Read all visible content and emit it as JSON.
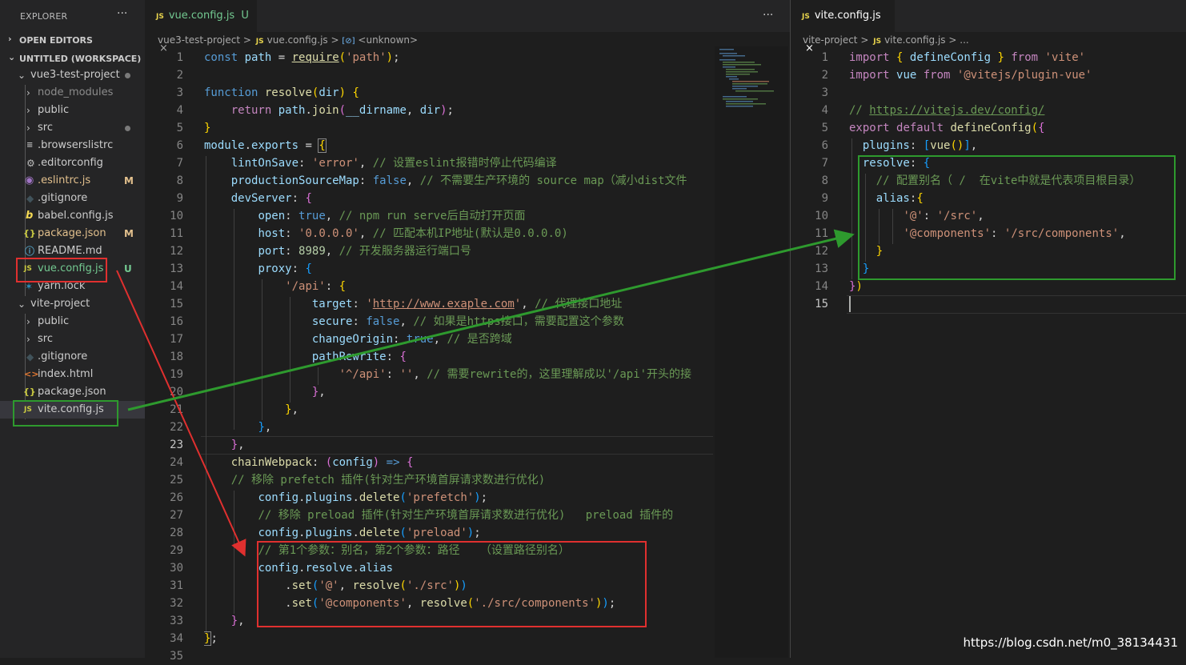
{
  "explorer": {
    "title": "EXPLORER",
    "more": "···",
    "open_editors": "OPEN EDITORS",
    "workspace": "UNTITLED (WORKSPACE)",
    "items": [
      {
        "name": "vue3-test-project",
        "type": "folder",
        "open": true
      },
      {
        "name": "node_modules",
        "type": "folder",
        "open": false
      },
      {
        "name": "public",
        "type": "folder",
        "open": false
      },
      {
        "name": "src",
        "type": "folder",
        "open": false
      },
      {
        "name": ".browserslistrc",
        "type": "file",
        "icon": "lines-icon"
      },
      {
        "name": ".editorconfig",
        "type": "file",
        "icon": "gear-icon"
      },
      {
        "name": ".eslintrc.js",
        "type": "file",
        "icon": "eslint-icon",
        "status": "M"
      },
      {
        "name": ".gitignore",
        "type": "file",
        "icon": "git-icon"
      },
      {
        "name": "babel.config.js",
        "type": "file",
        "icon": "babel-icon"
      },
      {
        "name": "package.json",
        "type": "file",
        "icon": "json-icon",
        "status": "M"
      },
      {
        "name": "README.md",
        "type": "file",
        "icon": "info-icon"
      },
      {
        "name": "vue.config.js",
        "type": "file",
        "icon": "js-icon",
        "status": "U"
      },
      {
        "name": "yarn.lock",
        "type": "file",
        "icon": "yarn-icon"
      },
      {
        "name": "vite-project",
        "type": "folder",
        "open": true
      },
      {
        "name": "public",
        "type": "folder",
        "open": false
      },
      {
        "name": "src",
        "type": "folder",
        "open": false
      },
      {
        "name": ".gitignore",
        "type": "file",
        "icon": "git-icon"
      },
      {
        "name": "index.html",
        "type": "file",
        "icon": "html-icon"
      },
      {
        "name": "package.json",
        "type": "file",
        "icon": "json-icon"
      },
      {
        "name": "vite.config.js",
        "type": "file",
        "icon": "js-icon"
      }
    ]
  },
  "left_editor": {
    "tab": {
      "name": "vue.config.js",
      "status": "U",
      "close": "×"
    },
    "more": "···",
    "breadcrumb": [
      "vue3-test-project",
      ">",
      "vue.config.js",
      ">",
      "<unknown>"
    ],
    "line_numbers": [
      "1",
      "2",
      "3",
      "4",
      "5",
      "6",
      "7",
      "8",
      "9",
      "10",
      "11",
      "12",
      "13",
      "14",
      "15",
      "16",
      "17",
      "18",
      "19",
      "20",
      "21",
      "22",
      "23",
      "24",
      "25",
      "26",
      "27",
      "28",
      "29",
      "30",
      "31",
      "32",
      "33",
      "34",
      "35"
    ],
    "active_line": "23"
  },
  "right_editor": {
    "tab": {
      "name": "vite.config.js",
      "close": "×"
    },
    "breadcrumb": [
      "vite-project",
      ">",
      "vite.config.js",
      ">",
      "..."
    ],
    "line_numbers": [
      "1",
      "2",
      "3",
      "4",
      "5",
      "6",
      "7",
      "8",
      "9",
      "10",
      "11",
      "12",
      "13",
      "14",
      "15"
    ],
    "active_line": "15"
  },
  "annotation_colors": {
    "red": "#e0302f",
    "green": "#2e9a2e"
  },
  "watermark": "https://blog.csdn.net/m0_38134431"
}
